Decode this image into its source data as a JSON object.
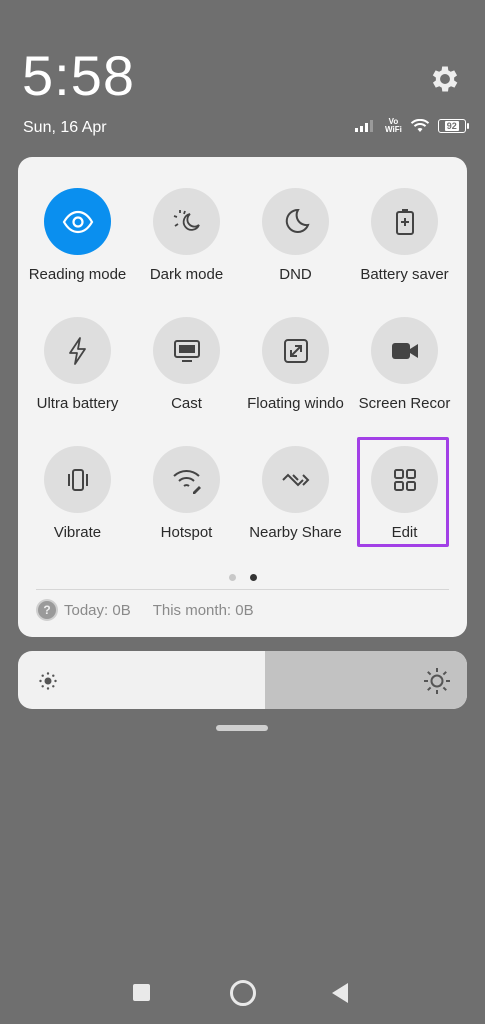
{
  "status": {
    "time": "5:58",
    "date": "Sun, 16 Apr",
    "volte_top": "Vo",
    "volte_bottom": "WiFi",
    "battery": "92"
  },
  "tiles": [
    {
      "label": "Reading mode",
      "icon": "eye-icon",
      "active": true
    },
    {
      "label": "Dark mode",
      "icon": "dark-mode-icon"
    },
    {
      "label": "DND",
      "icon": "moon-icon"
    },
    {
      "label": "Battery saver",
      "icon": "battery-saver-icon"
    },
    {
      "label": "Ultra battery",
      "icon": "lightning-icon"
    },
    {
      "label": "Cast",
      "icon": "cast-icon"
    },
    {
      "label": "Floating windo",
      "icon": "floating-window-icon"
    },
    {
      "label": "Screen Recor",
      "icon": "video-camera-icon"
    },
    {
      "label": "Vibrate",
      "icon": "vibrate-icon"
    },
    {
      "label": "Hotspot",
      "icon": "hotspot-icon"
    },
    {
      "label": "Nearby Share",
      "icon": "nearby-share-icon"
    },
    {
      "label": "Edit",
      "icon": "grid-icon"
    }
  ],
  "pager": {
    "pages": 2,
    "current": 2
  },
  "usage": {
    "help_icon": "?",
    "today": "Today: 0B",
    "month": "This month: 0B"
  },
  "colors": {
    "accent": "#0a8fef",
    "highlight": "#a23fe6",
    "background": "#6f6f6f"
  },
  "brightness": {
    "level": 0.55
  }
}
